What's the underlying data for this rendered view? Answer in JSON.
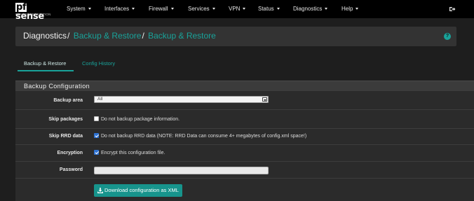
{
  "brand": {
    "name": "sense",
    "prefix": "pf",
    "edition": "COMMUNITY EDITION"
  },
  "nav": {
    "items": [
      "System",
      "Interfaces",
      "Firewall",
      "Services",
      "VPN",
      "Status",
      "Diagnostics",
      "Help"
    ],
    "logout_icon": "sign-out-icon"
  },
  "breadcrumb": {
    "root": "Diagnostics",
    "level1": "Backup & Restore",
    "level2": "Backup & Restore",
    "separator": "/",
    "help_icon": "question-circle-icon"
  },
  "tabs": [
    {
      "label": "Backup & Restore",
      "active": true
    },
    {
      "label": "Config History",
      "active": false
    }
  ],
  "panel": {
    "title": "Backup Configuration",
    "backup_area": {
      "label": "Backup area",
      "value": "All"
    },
    "skip_packages": {
      "label": "Skip packages",
      "checked": false,
      "text": "Do not backup package information."
    },
    "skip_rrd": {
      "label": "Skip RRD data",
      "checked": true,
      "text": "Do not backup RRD data (NOTE: RRD Data can consume 4+ megabytes of config.xml space!)"
    },
    "encryption": {
      "label": "Encryption",
      "checked": true,
      "text": "Encrypt this configuration file."
    },
    "password": {
      "label": "Password",
      "value": ""
    },
    "download_button": {
      "label": "Download configuration as XML",
      "icon": "download-icon"
    }
  },
  "colors": {
    "accent": "#19a39a",
    "button": "#17948c",
    "checkbox": "#2e72d2",
    "navbar": "#000000"
  }
}
